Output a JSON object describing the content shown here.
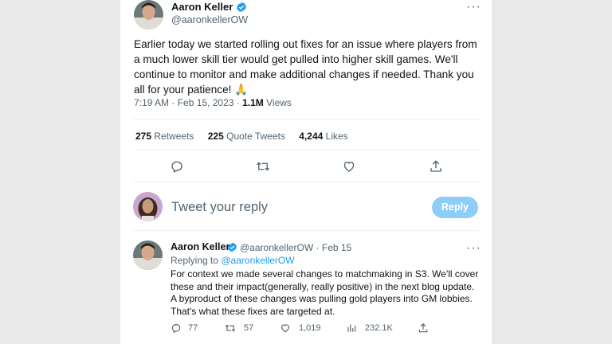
{
  "tweet": {
    "author_name": "Aaron Keller",
    "author_handle": "@aaronkellerOW",
    "text": "Earlier today we started rolling out fixes for an issue where players from a much lower skill tier would get pulled into higher skill games. We'll continue to monitor and make additional changes if needed. Thank you all for your patience! 🙏",
    "time": "7:19 AM · Feb 15, 2023 · ",
    "views_count": "1.1M",
    "views_label": "Views",
    "retweets_count": "275",
    "retweets_label": "Retweets",
    "quotes_count": "225",
    "quotes_label": "Quote Tweets",
    "likes_count": "4,244",
    "likes_label": "Likes",
    "more_icon": "more-icon",
    "actions": [
      "reply-icon",
      "retweet-icon",
      "like-icon",
      "share-icon"
    ]
  },
  "compose": {
    "placeholder": "Tweet your reply",
    "button_label": "Reply"
  },
  "reply": {
    "author_name": "Aaron Keller",
    "handle_date": "@aaronkellerOW · Feb 15",
    "replying_prefix": "Replying to ",
    "replying_handle": "@aaronkellerOW",
    "text": "For context we made several changes to matchmaking in S3. We'll cover these and their impact(generally, really positive) in the next blog update. A byproduct of these changes was pulling gold players into GM lobbies. That's what these fixes are targeted at.",
    "reply_count": "77",
    "retweet_count": "57",
    "like_count": "1,019",
    "views_count": "232.1K"
  },
  "colors": {
    "accent": "#1d9bf0",
    "reply_button": "#8ecdf8",
    "secondary_text": "#536471"
  }
}
